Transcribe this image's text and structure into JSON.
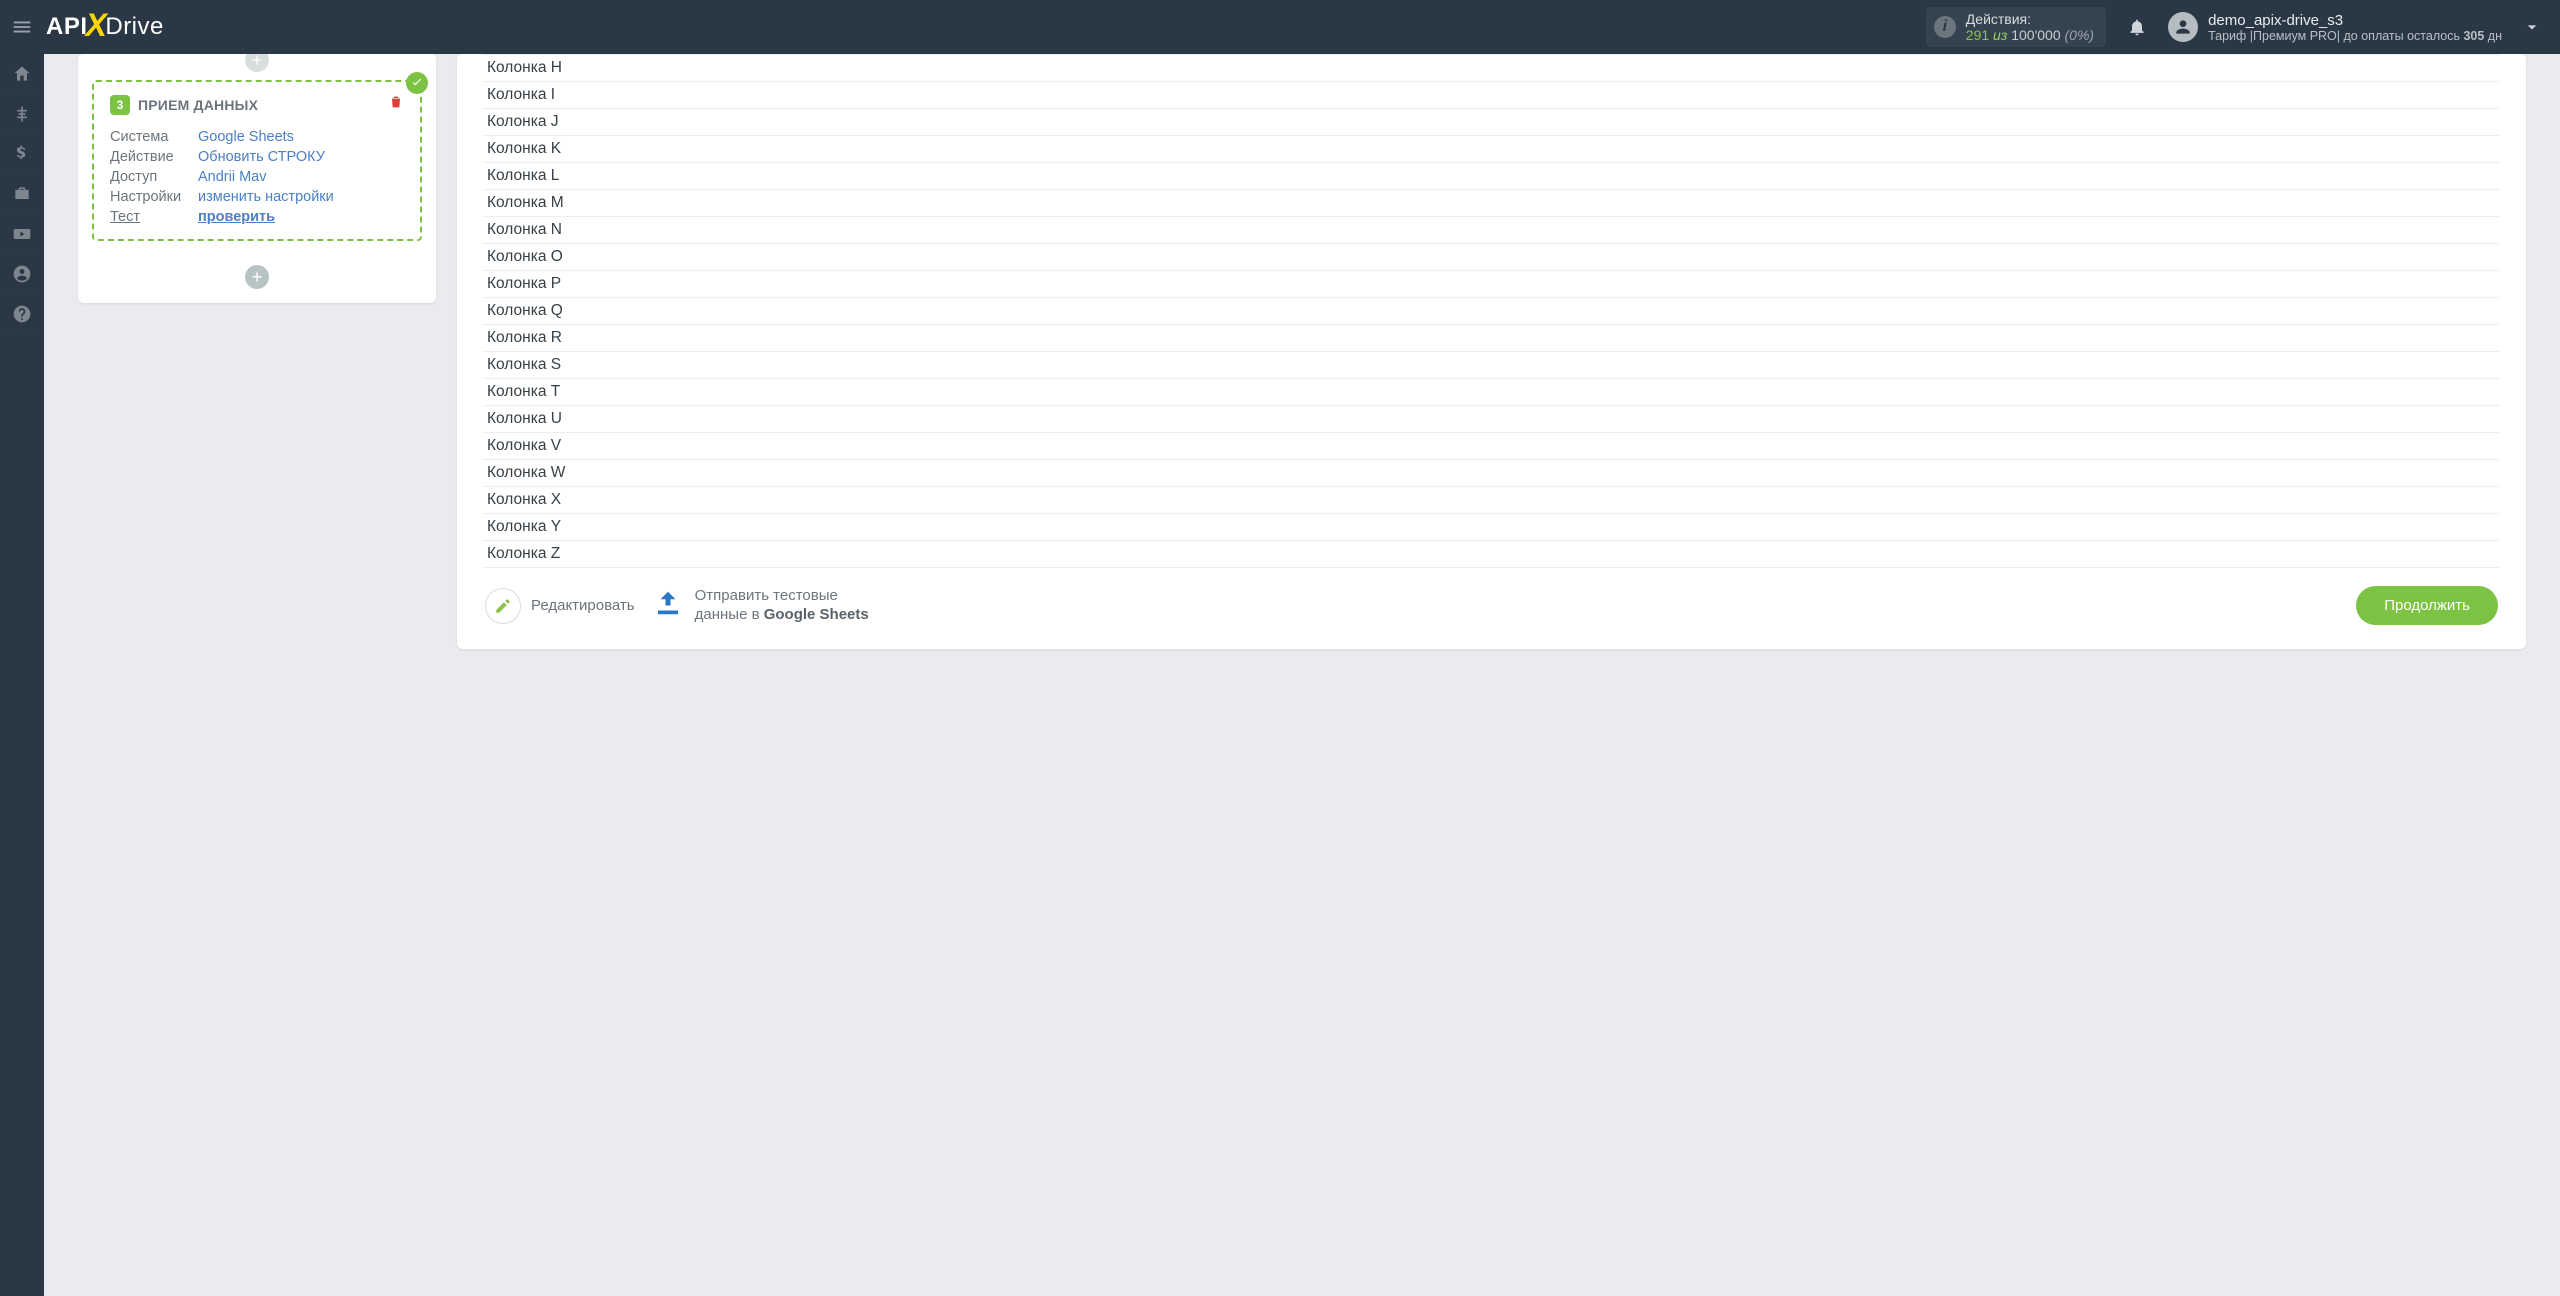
{
  "topbar": {
    "brand_a": "API",
    "brand_b": "Drive",
    "actions_label": "Действия:",
    "actions_count": "291",
    "actions_iz": "из",
    "actions_total": "100'000",
    "actions_pct": "(0%)",
    "user_name": "demo_apix-drive_s3",
    "tariff_prefix": "Тариф |",
    "tariff_name": "Премиум PRO",
    "tariff_mid": "|  до оплаты осталось ",
    "tariff_days": "305",
    "tariff_suffix": " дн"
  },
  "step": {
    "num": "3",
    "title": "ПРИЕМ ДАННЫХ",
    "rows": {
      "system_k": "Система",
      "system_v": "Google Sheets",
      "action_k": "Действие",
      "action_v": "Обновить СТРОКУ",
      "access_k": "Доступ",
      "access_v": "Andrii Mav",
      "settings_k": "Настройки",
      "settings_v": "изменить настройки",
      "test_k": "Тест",
      "test_v": "проверить"
    }
  },
  "columns": [
    "Колонка H",
    "Колонка I",
    "Колонка J",
    "Колонка K",
    "Колонка L",
    "Колонка M",
    "Колонка N",
    "Колонка O",
    "Колонка P",
    "Колонка Q",
    "Колонка R",
    "Колонка S",
    "Колонка T",
    "Колонка U",
    "Колонка V",
    "Колонка W",
    "Колонка X",
    "Колонка Y",
    "Колонка Z"
  ],
  "footer": {
    "edit": "Редактировать",
    "send_line1": "Отправить тестовые",
    "send_line2a": "данные в ",
    "send_line2b": "Google Sheets",
    "continue": "Продолжить"
  }
}
